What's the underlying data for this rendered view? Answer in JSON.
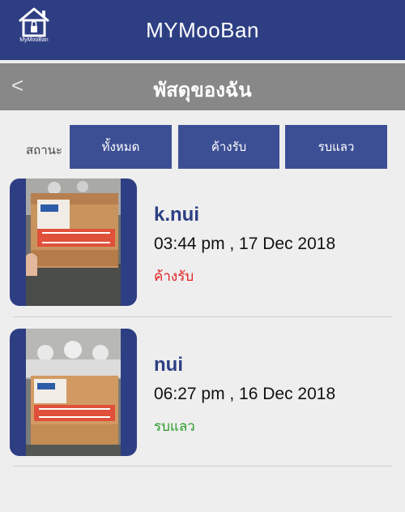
{
  "app": {
    "logo_text": "MyMooBan",
    "title": "MYMooBan"
  },
  "header": {
    "back": "<",
    "title": "พัสดุของฉัน"
  },
  "filter": {
    "label": "สถานะ",
    "tabs": [
      {
        "label": "ทั้งหมด"
      },
      {
        "label": "ค้างรับ"
      },
      {
        "label": "รบแลว"
      }
    ]
  },
  "parcels": [
    {
      "name": "k.nui",
      "datetime": "03:44 pm , 17 Dec 2018",
      "status": "ค้างรับ",
      "status_color": "#e02020"
    },
    {
      "name": "nui",
      "datetime": "06:27 pm , 16 Dec 2018",
      "status": "รบแลว",
      "status_color": "#2a9a2a"
    }
  ],
  "colors": {
    "primary": "#2d3e83",
    "tab": "#3d4f94",
    "titlebar": "#888888"
  },
  "icons": {
    "logo": "house-lock-icon",
    "back": "back-chevron-icon"
  }
}
